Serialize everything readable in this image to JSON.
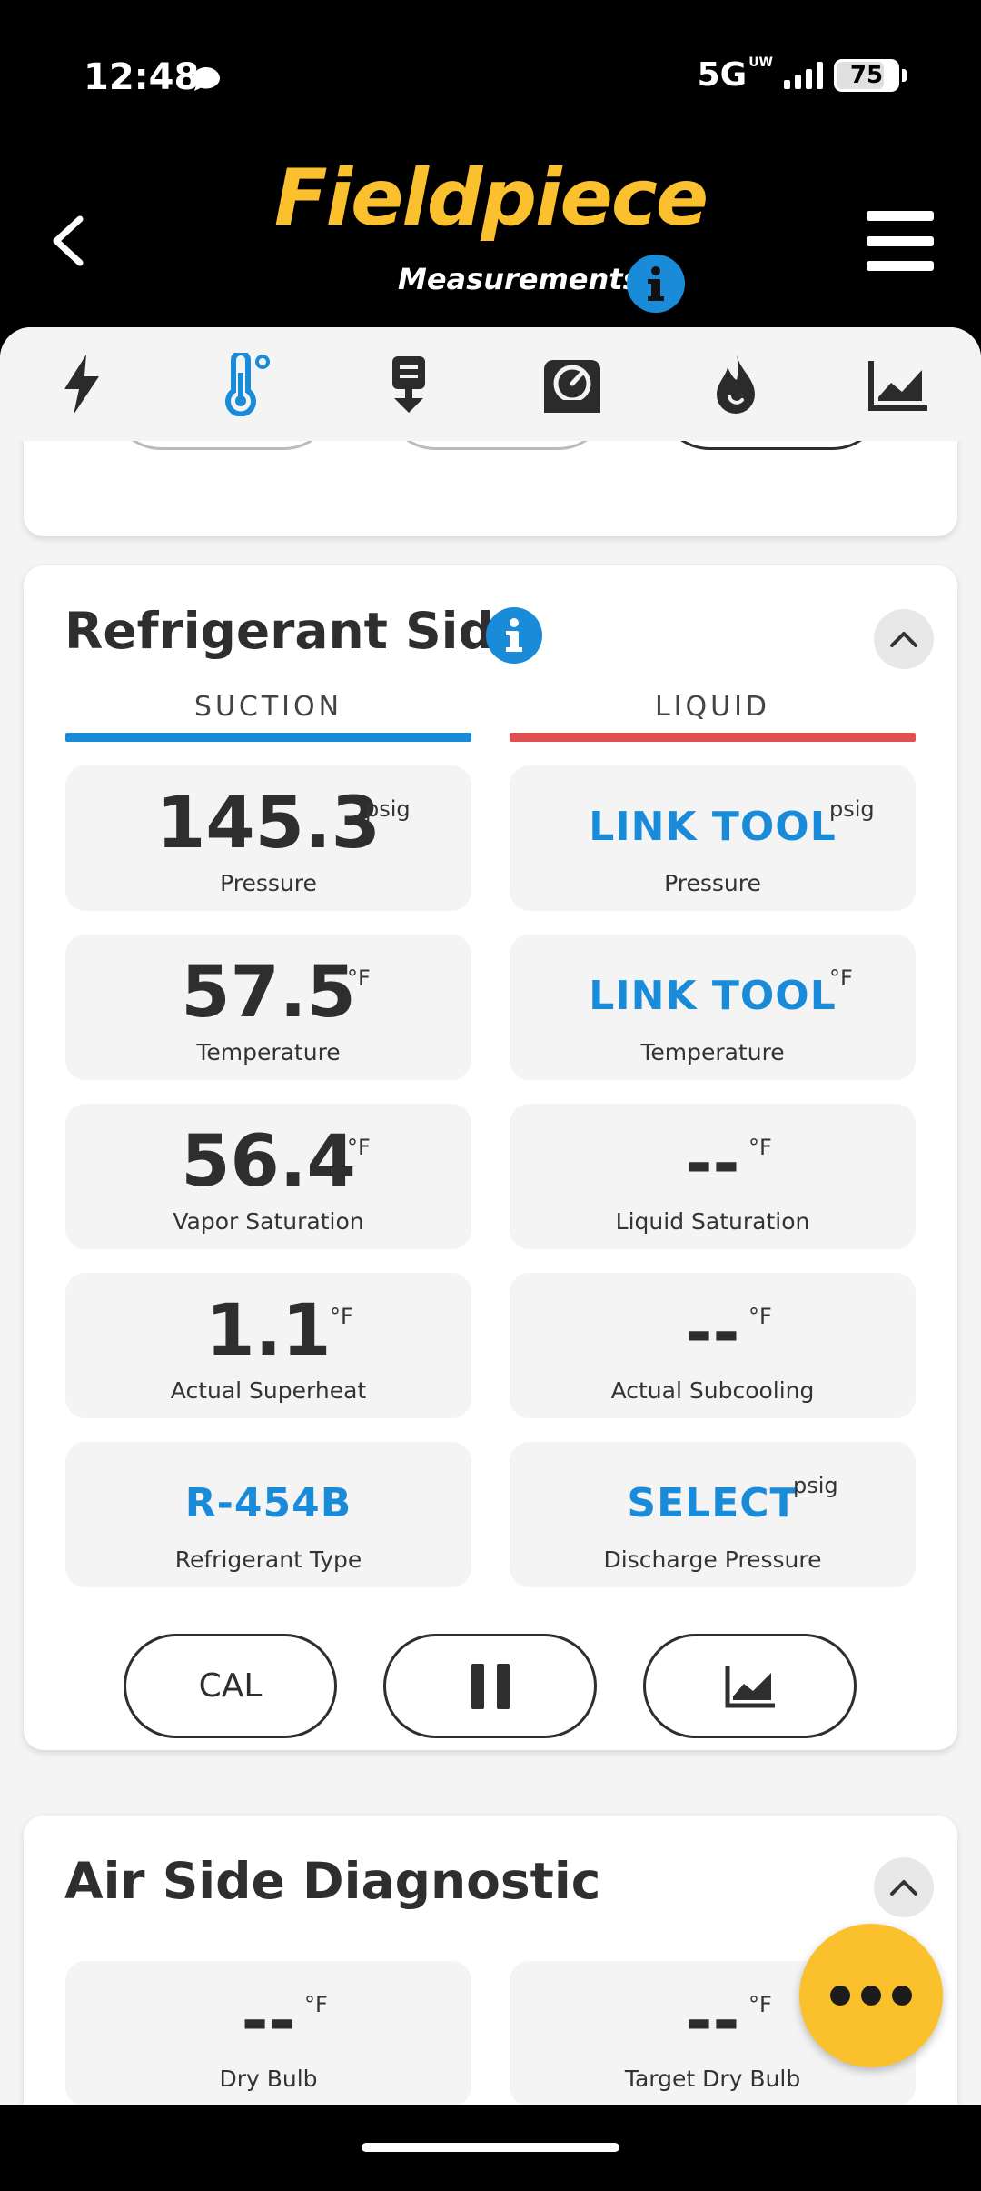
{
  "status_bar": {
    "time": "12:48",
    "network": "5G",
    "network_sub": "UW",
    "battery": "75"
  },
  "header": {
    "brand": "Fieldpiece",
    "subtitle": "Measurements"
  },
  "tabs": [
    {
      "name": "electrical",
      "icon": "lightning-icon",
      "active": false
    },
    {
      "name": "temperature",
      "icon": "thermometer-icon",
      "active": true
    },
    {
      "name": "download",
      "icon": "download-icon",
      "active": false
    },
    {
      "name": "gauge",
      "icon": "gauge-icon",
      "active": false
    },
    {
      "name": "combustion",
      "icon": "flame-icon",
      "active": false
    },
    {
      "name": "trend",
      "icon": "chart-icon",
      "active": false
    }
  ],
  "refrigerant": {
    "title": "Refrigerant Side",
    "suction_label": "SUCTION",
    "liquid_label": "LIQUID",
    "suction": {
      "pressure": {
        "value": "145.3",
        "unit": "psig",
        "label": "Pressure"
      },
      "temperature": {
        "value": "57.5",
        "unit": "°F",
        "label": "Temperature"
      },
      "vapor_saturation": {
        "value": "56.4",
        "unit": "°F",
        "label": "Vapor Saturation"
      },
      "superheat": {
        "value": "1.1",
        "unit": "°F",
        "label": "Actual Superheat"
      },
      "refrigerant_type": {
        "value": "R-454B",
        "label": "Refrigerant Type"
      }
    },
    "liquid": {
      "pressure": {
        "value": "LINK TOOL",
        "unit": "psig",
        "label": "Pressure"
      },
      "temperature": {
        "value": "LINK TOOL",
        "unit": "°F",
        "label": "Temperature"
      },
      "liquid_saturation": {
        "value": "--",
        "unit": "°F",
        "label": "Liquid Saturation"
      },
      "subcooling": {
        "value": "--",
        "unit": "°F",
        "label": "Actual Subcooling"
      },
      "discharge_pressure": {
        "value": "SELECT",
        "unit": "psig",
        "label": "Discharge Pressure"
      }
    },
    "actions": {
      "cal_label": "CAL"
    }
  },
  "air_side": {
    "title": "Air Side Diagnostic",
    "dry_bulb": {
      "value": "--",
      "unit": "°F",
      "label": "Dry Bulb"
    },
    "target_dry_bulb": {
      "value": "--",
      "unit": "°F",
      "label": "Target Dry Bulb"
    }
  },
  "colors": {
    "brand_yellow": "#fbc02d",
    "accent_blue": "#1a8bd8",
    "suction_bar": "#1a8bd8",
    "liquid_bar": "#e05050"
  }
}
